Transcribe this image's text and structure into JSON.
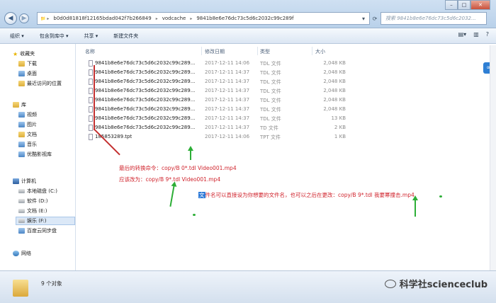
{
  "window": {
    "breadcrumb": [
      "b0d0d81818f12165bdad042f7b266849",
      "vodcache",
      "9841b8e6e76dc73c5d6c2032c99c289f"
    ],
    "search_placeholder": "搜索 9841b8e6e76dc73c5d6c2032..."
  },
  "toolbar": {
    "organize": "组织 ▾",
    "include_library": "包含到库中 ▾",
    "share": "共享 ▾",
    "new_folder": "新建文件夹"
  },
  "nav": {
    "favorites_header": "收藏夹",
    "favorites": [
      "下载",
      "桌面",
      "最近访问的位置"
    ],
    "libraries_header": "库",
    "libraries": [
      "视频",
      "图片",
      "文档",
      "音乐",
      "优酷影视库"
    ],
    "computer_header": "计算机",
    "drives": [
      "本地磁盘 (C:)",
      "软件 (D:)",
      "文档 (E:)",
      "娱乐 (F:)",
      "百度云同步盘"
    ],
    "network": "网络"
  },
  "columns": {
    "name": "名称",
    "date": "修改日期",
    "type": "类型",
    "size": "大小"
  },
  "files": [
    {
      "name": "9841b8e6e76dc73c5d6c2032c99c289...",
      "date": "2017-12-11 14:06",
      "type": "TDL 文件",
      "size": "2,048 KB"
    },
    {
      "name": "9841b8e6e76dc73c5d6c2032c99c289...",
      "date": "2017-12-11 14:37",
      "type": "TDL 文件",
      "size": "2,048 KB"
    },
    {
      "name": "9841b8e6e76dc73c5d6c2032c99c289...",
      "date": "2017-12-11 14:37",
      "type": "TDL 文件",
      "size": "2,048 KB"
    },
    {
      "name": "9841b8e6e76dc73c5d6c2032c99c289...",
      "date": "2017-12-11 14:37",
      "type": "TDL 文件",
      "size": "2,048 KB"
    },
    {
      "name": "9841b8e6e76dc73c5d6c2032c99c289...",
      "date": "2017-12-11 14:37",
      "type": "TDL 文件",
      "size": "2,048 KB"
    },
    {
      "name": "9841b8e6e76dc73c5d6c2032c99c289...",
      "date": "2017-12-11 14:37",
      "type": "TDL 文件",
      "size": "2,048 KB"
    },
    {
      "name": "9841b8e6e76dc73c5d6c2032c99c289...",
      "date": "2017-12-11 14:37",
      "type": "TDL 文件",
      "size": "13 KB"
    },
    {
      "name": "9841b8e6e76dc73c5d6c2032c99c289...",
      "date": "2017-12-11 14:37",
      "type": "TD 文件",
      "size": "2 KB"
    },
    {
      "name": "185853289.tpt",
      "date": "2017-12-11 14:06",
      "type": "TPT 文件",
      "size": "1 KB"
    }
  ],
  "annotations": {
    "cmd1": "最后的转换命令：copy/B 0*.tdl Video001.mp4",
    "cmd2": "应该改为：copy/B 9*.tdl Video001.mp4",
    "tip_highlight": "文",
    "tip_rest": "件名可以直接设为你想要的文件名，也可以之后在更改：copy/B 9*.tdl 我要幂撞击.mp4"
  },
  "status": {
    "count": "9 个对象",
    "watermark": "科学社scienceclub"
  },
  "colors": {
    "annotation_red": "#d0242d",
    "arrow_green": "#2cae36",
    "highlight_blue": "#2f7bd8"
  }
}
